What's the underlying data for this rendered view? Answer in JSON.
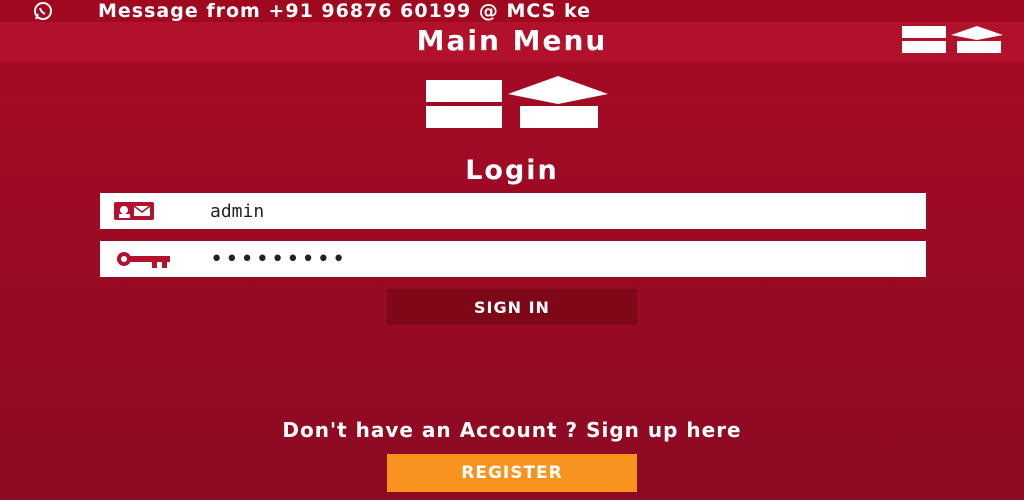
{
  "notification": {
    "icon": "whatsapp-icon",
    "text": "Message from +91 96876 60199 @ MCS ke"
  },
  "header": {
    "title": "Main Menu",
    "logo_icon": "brand-logo-icon"
  },
  "login": {
    "title": "Login",
    "username_value": "admin",
    "username_icon": "id-card-icon",
    "password_value": "•••••••••",
    "password_icon": "key-icon",
    "signin_label": "SIGN IN"
  },
  "signup": {
    "prompt": "Don't have an Account ? Sign up here",
    "register_label": "REGISTER"
  },
  "colors": {
    "background": "#9c0a25",
    "title_bar": "#b2112b",
    "signin_button": "#7e0718",
    "register_button": "#f8931f",
    "icon_accent": "#b3122e"
  }
}
